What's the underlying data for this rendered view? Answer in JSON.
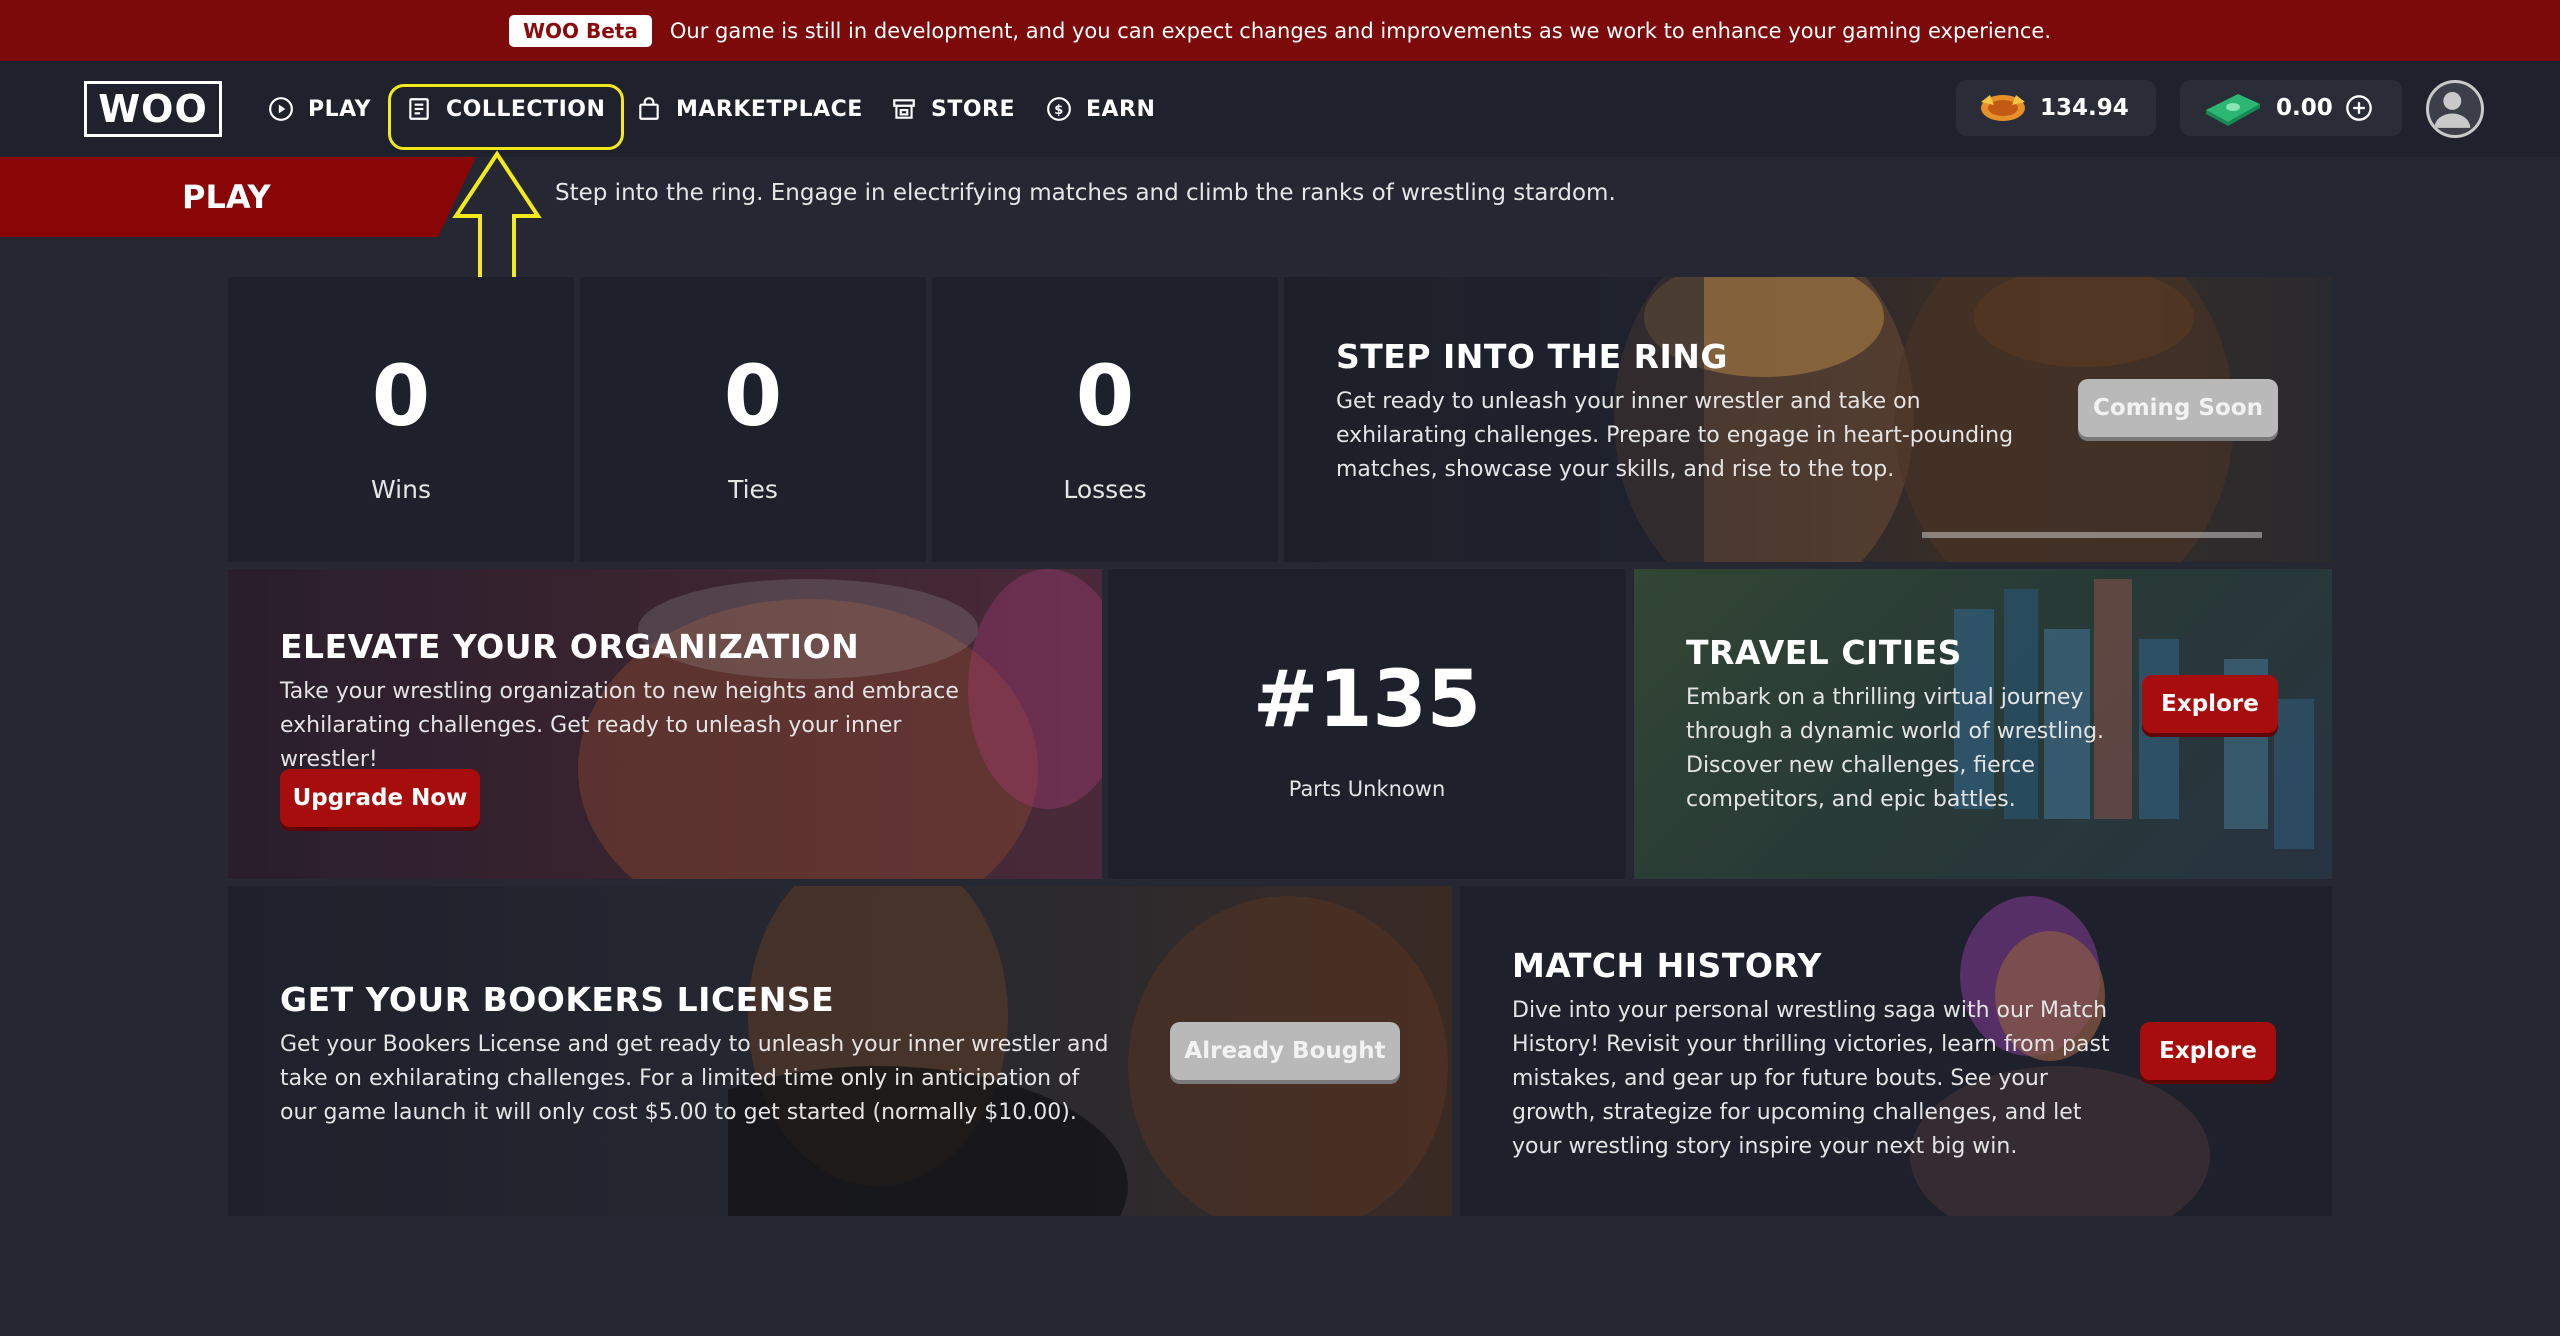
{
  "beta": {
    "badge": "WOO Beta",
    "message": "Our game is still in development, and you can expect changes and improvements as we work to enhance your gaming experience."
  },
  "nav": {
    "logo": "WOO",
    "items": [
      {
        "label": "PLAY",
        "icon": "play-circle-icon"
      },
      {
        "label": "COLLECTION",
        "icon": "list-icon"
      },
      {
        "label": "MARKETPLACE",
        "icon": "bag-icon"
      },
      {
        "label": "STORE",
        "icon": "store-icon"
      },
      {
        "label": "EARN",
        "icon": "dollar-circle-icon"
      }
    ],
    "woo_balance": "134.94",
    "cash_balance": "0.00"
  },
  "page": {
    "title": "PLAY",
    "subtitle": "Step into the ring. Engage in electrifying matches and climb the ranks of wrestling stardom."
  },
  "stats": [
    {
      "value": "0",
      "label": "Wins"
    },
    {
      "value": "0",
      "label": "Ties"
    },
    {
      "value": "0",
      "label": "Losses"
    }
  ],
  "cards": {
    "ring": {
      "title": "STEP INTO THE RING",
      "body": "Get ready to unleash your inner wrestler and take on exhilarating challenges. Prepare to engage in heart-pounding matches, showcase your skills, and rise to the top.",
      "button": "Coming Soon"
    },
    "organization": {
      "title": "ELEVATE YOUR ORGANIZATION",
      "body": "Take your wrestling organization to new heights and embrace exhilarating challenges. Get ready to unleash your inner wrestler!",
      "button": "Upgrade Now"
    },
    "rank": {
      "value": "#135",
      "label": "Parts Unknown"
    },
    "travel": {
      "title": "TRAVEL CITIES",
      "body": "Embark on a thrilling virtual journey through a dynamic world of wrestling. Discover new challenges, fierce competitors, and epic battles.",
      "button": "Explore"
    },
    "license": {
      "title": "GET YOUR BOOKERS LICENSE",
      "body": "Get your Bookers License and get ready to unleash your inner wrestler and take on exhilarating challenges. For a limited time only in anticipation of our game launch it will only cost $5.00 to get started (normally $10.00).",
      "button": "Already Bought"
    },
    "history": {
      "title": "MATCH HISTORY",
      "body": "Dive into your personal wrestling saga with our Match History! Revisit your thrilling victories, learn from past mistakes, and gear up for future bouts. See your growth, strategize for upcoming challenges, and let your wrestling story inspire your next big win.",
      "button": "Explore"
    }
  },
  "colors": {
    "accent_red": "#a80d0d",
    "banner_red": "#7d0a0a",
    "highlight_yellow": "#f2ea1a",
    "background": "#252733"
  }
}
